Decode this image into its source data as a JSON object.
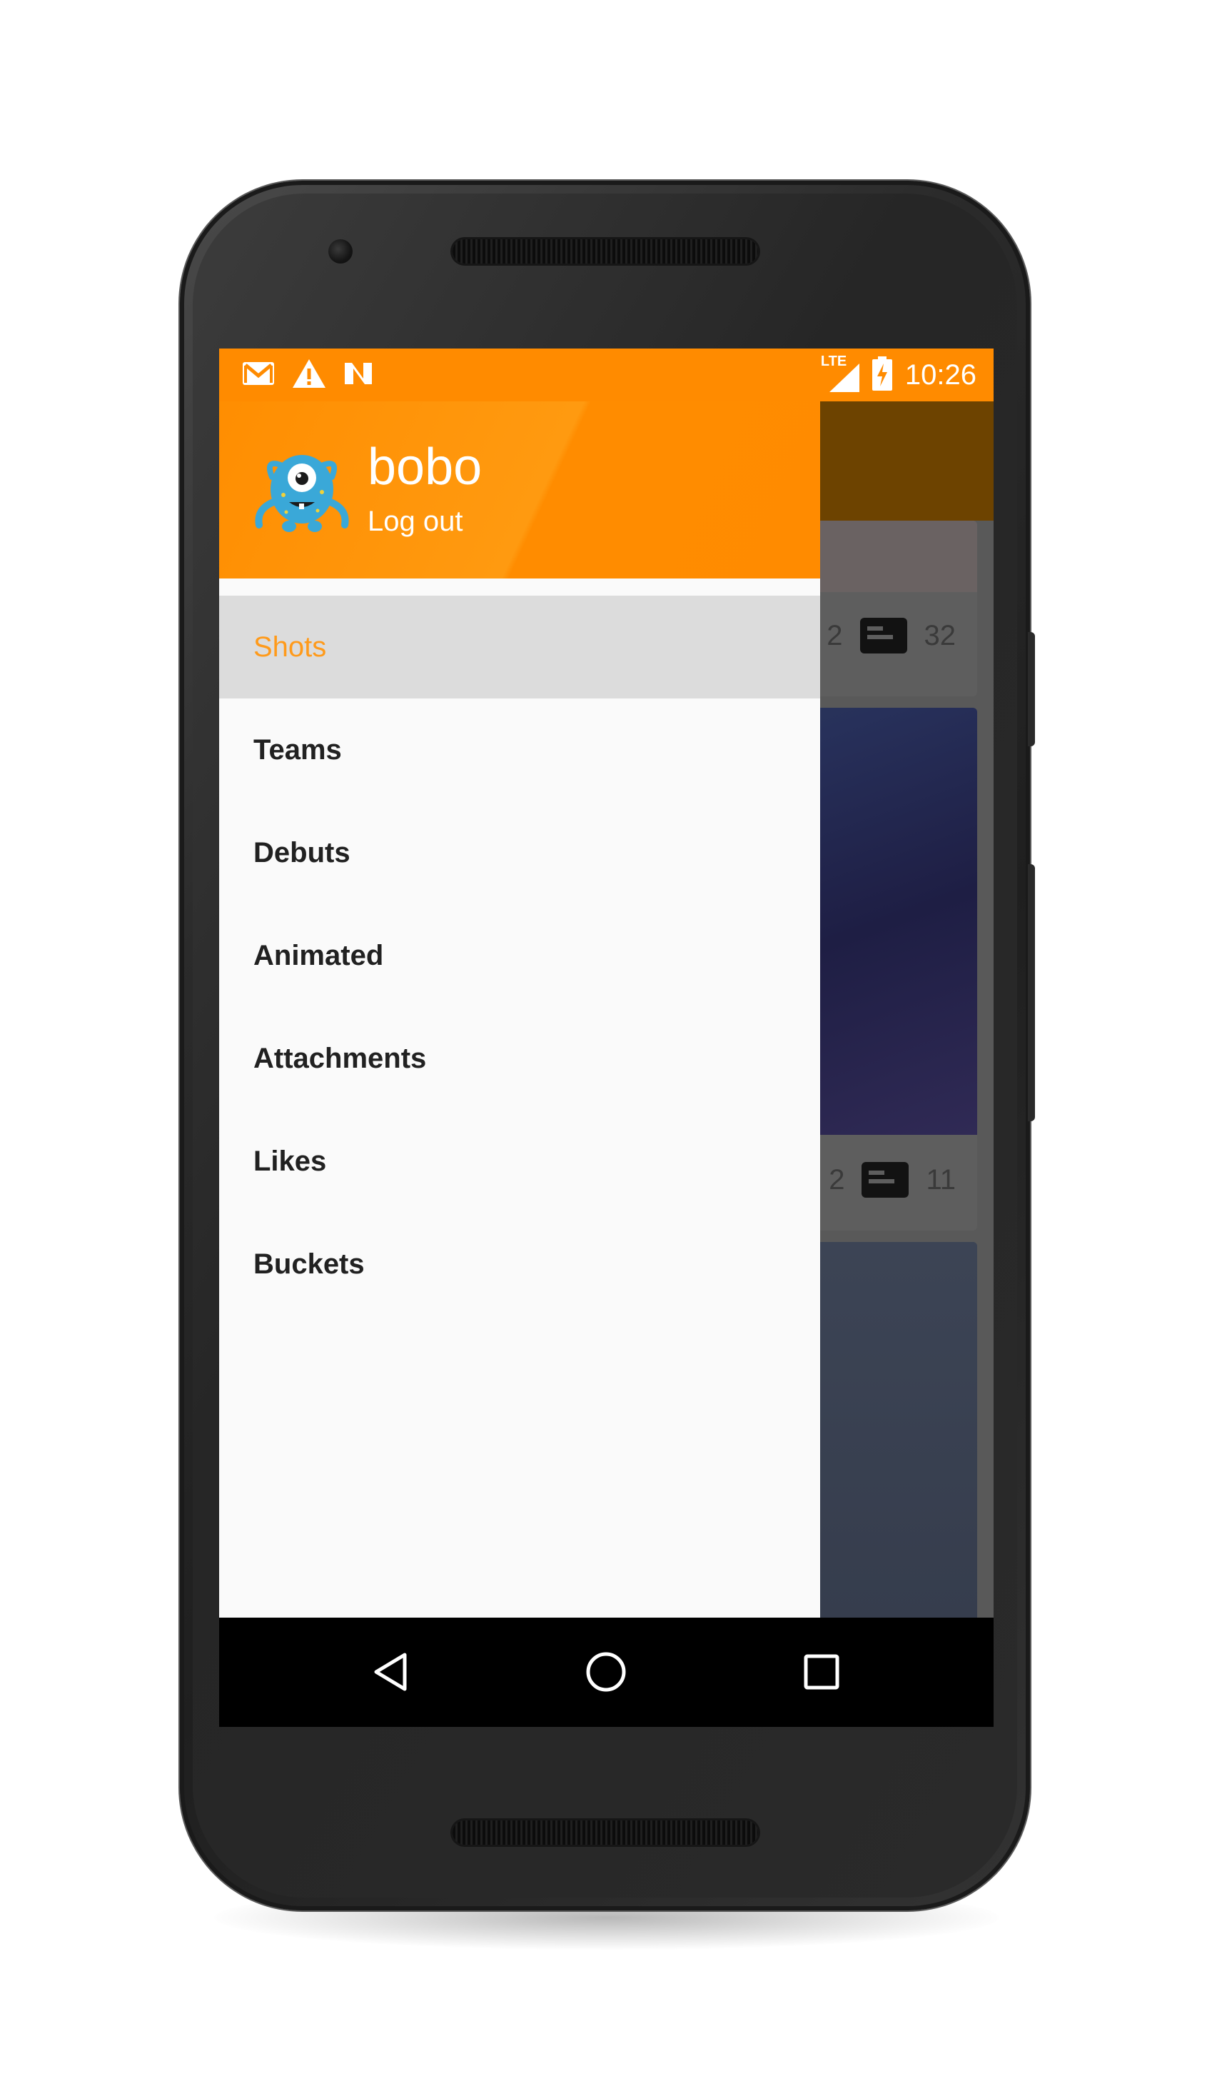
{
  "status_bar": {
    "time": "10:26",
    "network": "LTE",
    "left_icons": [
      "gmail-icon",
      "warning-icon",
      "n-icon"
    ],
    "right_icons": [
      "signal-icon",
      "battery-charging-icon"
    ]
  },
  "drawer": {
    "user_name": "bobo",
    "logout_label": "Log out",
    "menu": [
      {
        "label": "Shots",
        "active": true
      },
      {
        "label": "Teams",
        "active": false
      },
      {
        "label": "Debuts",
        "active": false
      },
      {
        "label": "Animated",
        "active": false
      },
      {
        "label": "Attachments",
        "active": false
      },
      {
        "label": "Likes",
        "active": false
      },
      {
        "label": "Buckets",
        "active": false
      }
    ]
  },
  "background_feed": {
    "cards": [
      {
        "partial_count": "2",
        "comments": "32"
      },
      {
        "partial_count": "2",
        "comments": "11"
      }
    ]
  },
  "navigation_bar": {
    "buttons": [
      "back-icon",
      "home-icon",
      "recents-icon"
    ]
  },
  "colors": {
    "accent": "#ff8b00",
    "active_item_text": "#ff9a1a",
    "active_item_bg": "#dcdcdc",
    "drawer_bg": "#fafafa"
  }
}
